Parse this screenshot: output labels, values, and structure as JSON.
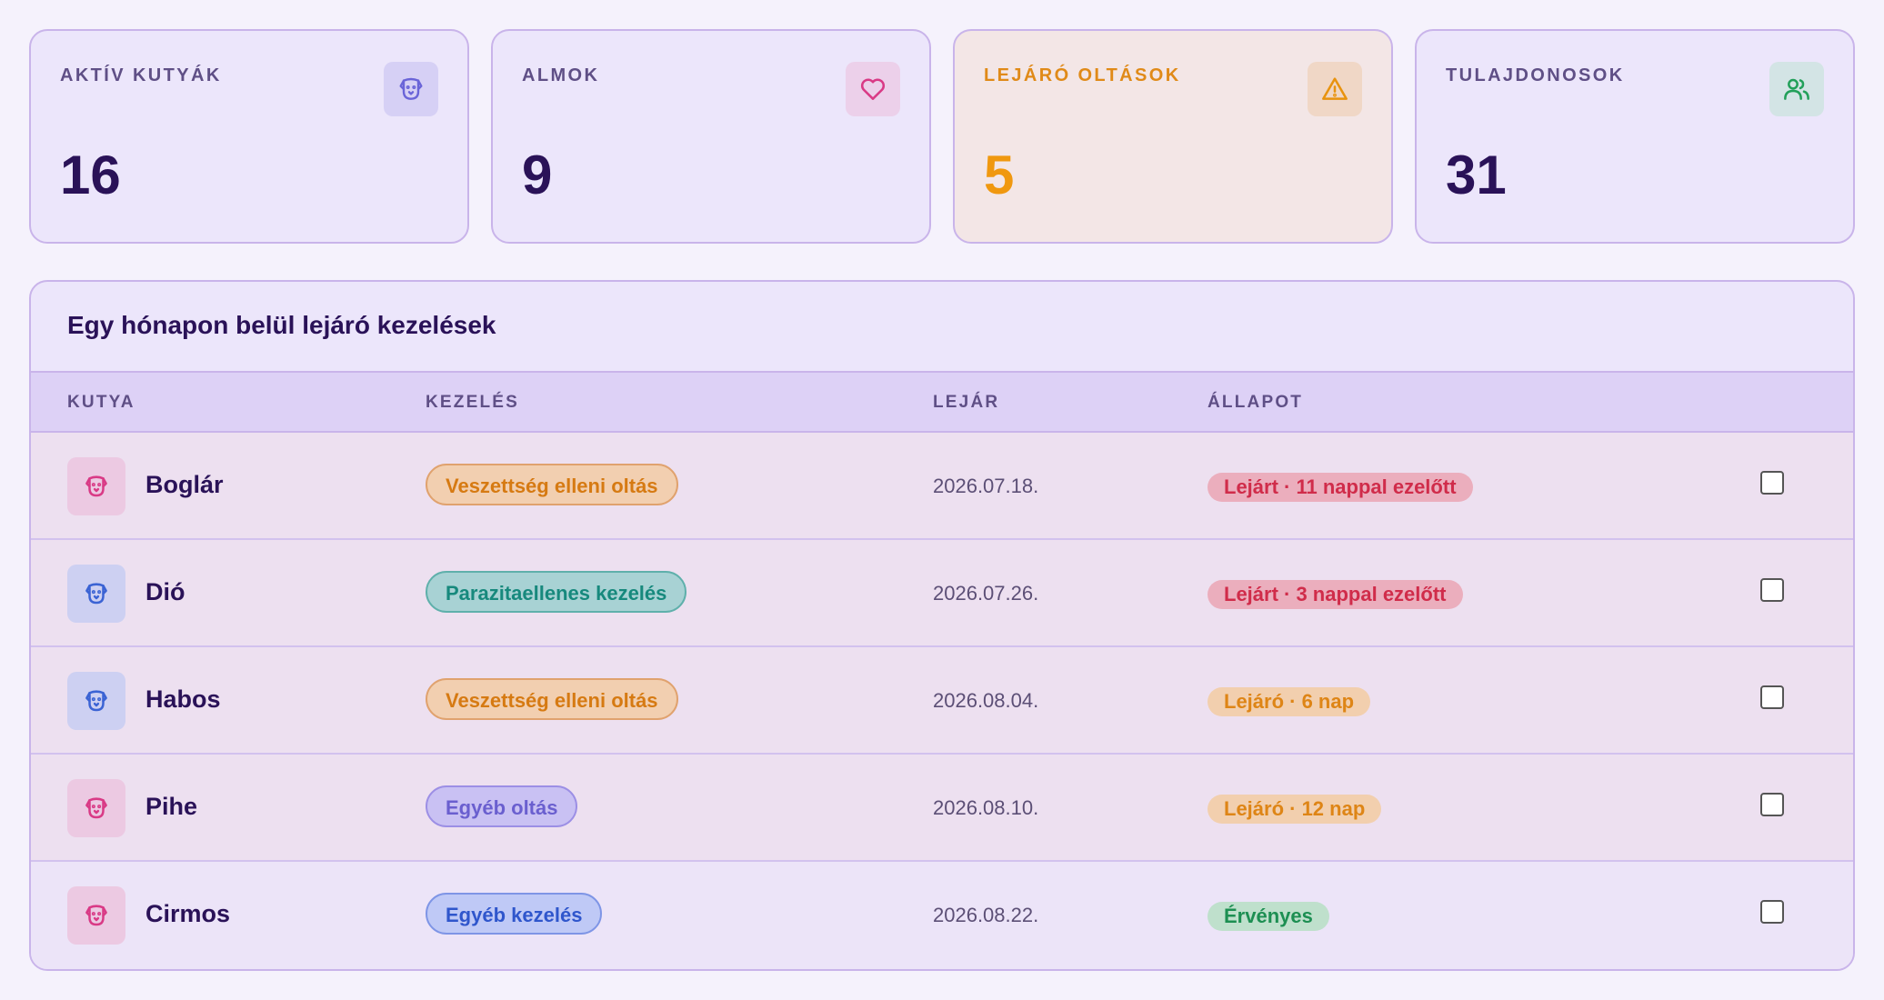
{
  "stats": [
    {
      "label": "AKTÍV KUTYÁK",
      "value": "16",
      "icon": "dog-icon",
      "icon_color": "#6a64d8",
      "icon_bg": "#d6d0f5"
    },
    {
      "label": "ALMOK",
      "value": "9",
      "icon": "heart-icon",
      "icon_color": "#d93a86",
      "icon_bg": "#ecd0ea"
    },
    {
      "label": "LEJÁRÓ OLTÁSOK",
      "value": "5",
      "icon": "warning-icon",
      "icon_color": "#e8930f",
      "icon_bg": "#f0d7c6"
    },
    {
      "label": "TULAJDONOSOK",
      "value": "31",
      "icon": "users-icon",
      "icon_color": "#22a05a",
      "icon_bg": "#d3e4e5"
    }
  ],
  "panel": {
    "title": "Egy hónapon belül lejáró kezelések",
    "columns": {
      "dog": "KUTYA",
      "treatment": "KEZELÉS",
      "expires": "LEJÁR",
      "status": "ÁLLAPOT"
    }
  },
  "rows": [
    {
      "dog": "Boglár",
      "avatar_icon": "dog-icon",
      "avatar_color": "#d93a86",
      "avatar_bg": "#ecc9e2",
      "treatment": "Veszettség elleni oltás",
      "treatment_kind": "rabies",
      "expires": "2026.07.18.",
      "status": "Lejárt · 11 nappal ezelőtt",
      "status_kind": "expired",
      "checked": false
    },
    {
      "dog": "Dió",
      "avatar_icon": "dog-icon",
      "avatar_color": "#3b63d4",
      "avatar_bg": "#cdd0f2",
      "treatment": "Parazitaellenes kezelés",
      "treatment_kind": "parasite",
      "expires": "2026.07.26.",
      "status": "Lejárt · 3 nappal ezelőtt",
      "status_kind": "expired",
      "checked": false
    },
    {
      "dog": "Habos",
      "avatar_icon": "dog-icon",
      "avatar_color": "#3b63d4",
      "avatar_bg": "#cdd0f2",
      "treatment": "Veszettség elleni oltás",
      "treatment_kind": "rabies",
      "expires": "2026.08.04.",
      "status": "Lejáró · 6 nap",
      "status_kind": "expiring",
      "checked": false
    },
    {
      "dog": "Pihe",
      "avatar_icon": "dog-icon",
      "avatar_color": "#d93a86",
      "avatar_bg": "#ecc9e2",
      "treatment": "Egyéb oltás",
      "treatment_kind": "other-vaccine",
      "expires": "2026.08.10.",
      "status": "Lejáró · 12 nap",
      "status_kind": "expiring",
      "checked": false
    },
    {
      "dog": "Cirmos",
      "avatar_icon": "dog-icon",
      "avatar_color": "#d93a86",
      "avatar_bg": "#ecc9e2",
      "treatment": "Egyéb kezelés",
      "treatment_kind": "other-treatment",
      "expires": "2026.08.22.",
      "status": "Érvényes",
      "status_kind": "valid",
      "checked": false
    }
  ],
  "pill_colors": {
    "rabies": {
      "bg": "#f2cfb0",
      "border": "#e0a26e",
      "text": "#d67a12"
    },
    "parasite": {
      "bg": "#a8d2d4",
      "border": "#5fb0ab",
      "text": "#17897d"
    },
    "other-vaccine": {
      "bg": "#c9c1f3",
      "border": "#9c8fe5",
      "text": "#6a5fcf"
    },
    "other-treatment": {
      "bg": "#bfc9f6",
      "border": "#7e95e6",
      "text": "#2f56cc"
    }
  },
  "status_colors": {
    "expired": {
      "bg": "#ebaebd",
      "text": "#d02c4a"
    },
    "expiring": {
      "bg": "#f2cfae",
      "text": "#de8516"
    },
    "valid": {
      "bg": "#bfe0cc",
      "text": "#1d8f52"
    }
  }
}
